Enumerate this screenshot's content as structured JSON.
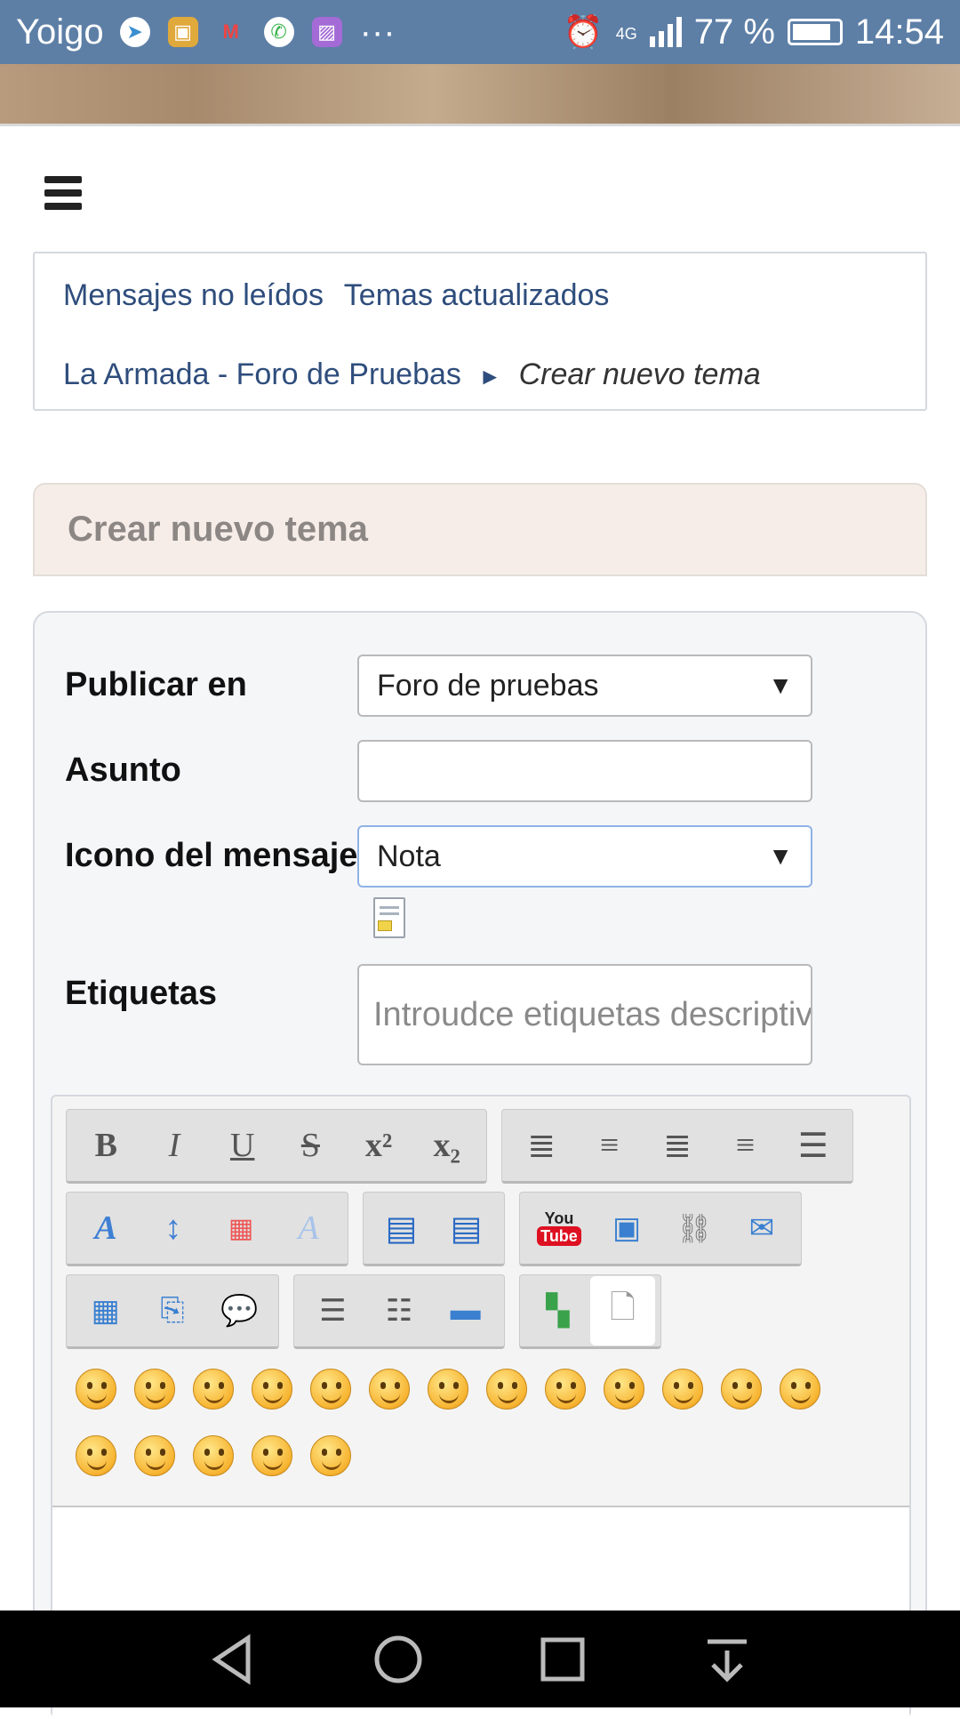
{
  "status_bar": {
    "carrier": "Yoigo",
    "more": "···",
    "network": "4G",
    "battery": "77 %",
    "time": "14:54"
  },
  "nav": {
    "unread": "Mensajes no leídos",
    "updated": "Temas actualizados",
    "forum": "La Armada - Foro de Pruebas",
    "separator": "►",
    "current": "Crear nuevo tema"
  },
  "page_title": "Crear nuevo tema",
  "form": {
    "post_in_label": "Publicar en",
    "post_in_value": "Foro de pruebas",
    "subject_label": "Asunto",
    "subject_value": "",
    "icon_label": "Icono del mensaje",
    "icon_value": "Nota",
    "tags_label": "Etiquetas",
    "tags_placeholder": "Introudce etiquetas descriptivas"
  },
  "toolbar": {
    "bold": "B",
    "italic": "I",
    "underline": "U",
    "strike": "S",
    "superscript": "x²",
    "subscript": "x₂",
    "youtube_top": "You",
    "youtube_bottom": "Tube"
  },
  "smileys_row1": 13,
  "smileys_row2": 5
}
